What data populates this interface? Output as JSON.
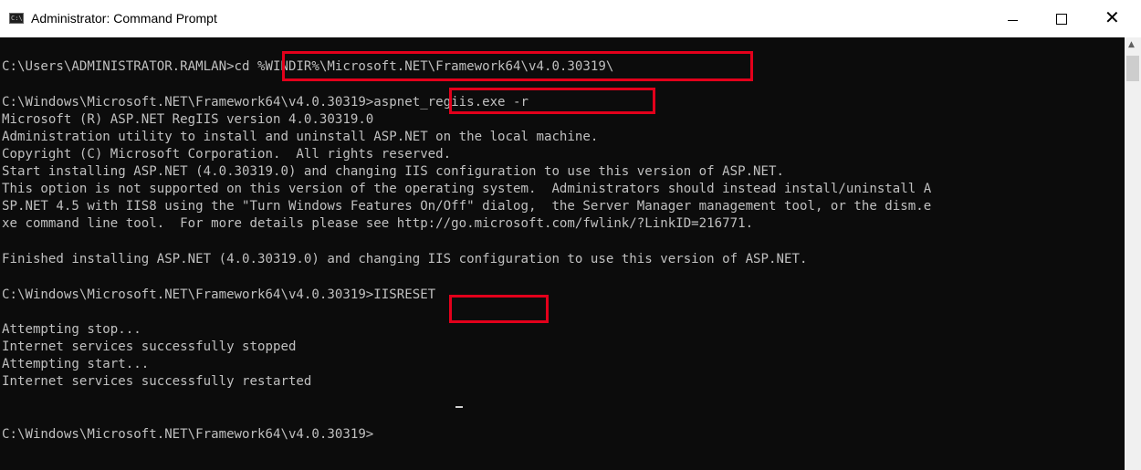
{
  "window": {
    "title": "Administrator: Command Prompt",
    "icon_text": "C:\\."
  },
  "controls": {
    "minimize_icon": "minimize-icon",
    "maximize_icon": "maximize-icon",
    "close_icon": "close-icon",
    "close_glyph": "✕"
  },
  "console": {
    "lines": [
      "C:\\Users\\ADMINISTRATOR.RAMLAN>cd %WINDIR%\\Microsoft.NET\\Framework64\\v4.0.30319\\",
      "C:\\Windows\\Microsoft.NET\\Framework64\\v4.0.30319>aspnet_regiis.exe -r",
      "Microsoft (R) ASP.NET RegIIS version 4.0.30319.0",
      "Administration utility to install and uninstall ASP.NET on the local machine.",
      "Copyright (C) Microsoft Corporation.  All rights reserved.",
      "Start installing ASP.NET (4.0.30319.0) and changing IIS configuration to use this version of ASP.NET.",
      "This option is not supported on this version of the operating system.  Administrators should instead install/uninstall A",
      "SP.NET 4.5 with IIS8 using the \"Turn Windows Features On/Off\" dialog,  the Server Manager management tool, or the dism.e",
      "xe command line tool.  For more details please see http://go.microsoft.com/fwlink/?LinkID=216771.",
      "Finished installing ASP.NET (4.0.30319.0) and changing IIS configuration to use this version of ASP.NET.",
      "C:\\Windows\\Microsoft.NET\\Framework64\\v4.0.30319>IISRESET",
      "Attempting stop...",
      "Internet services successfully stopped",
      "Attempting start...",
      "Internet services successfully restarted",
      "C:\\Windows\\Microsoft.NET\\Framework64\\v4.0.30319>"
    ]
  },
  "colors": {
    "console_bg": "#0c0c0c",
    "console_text": "#c0c0c0",
    "highlight_border": "#e3001b"
  },
  "scrollbar": {
    "up_arrow": "▲"
  }
}
